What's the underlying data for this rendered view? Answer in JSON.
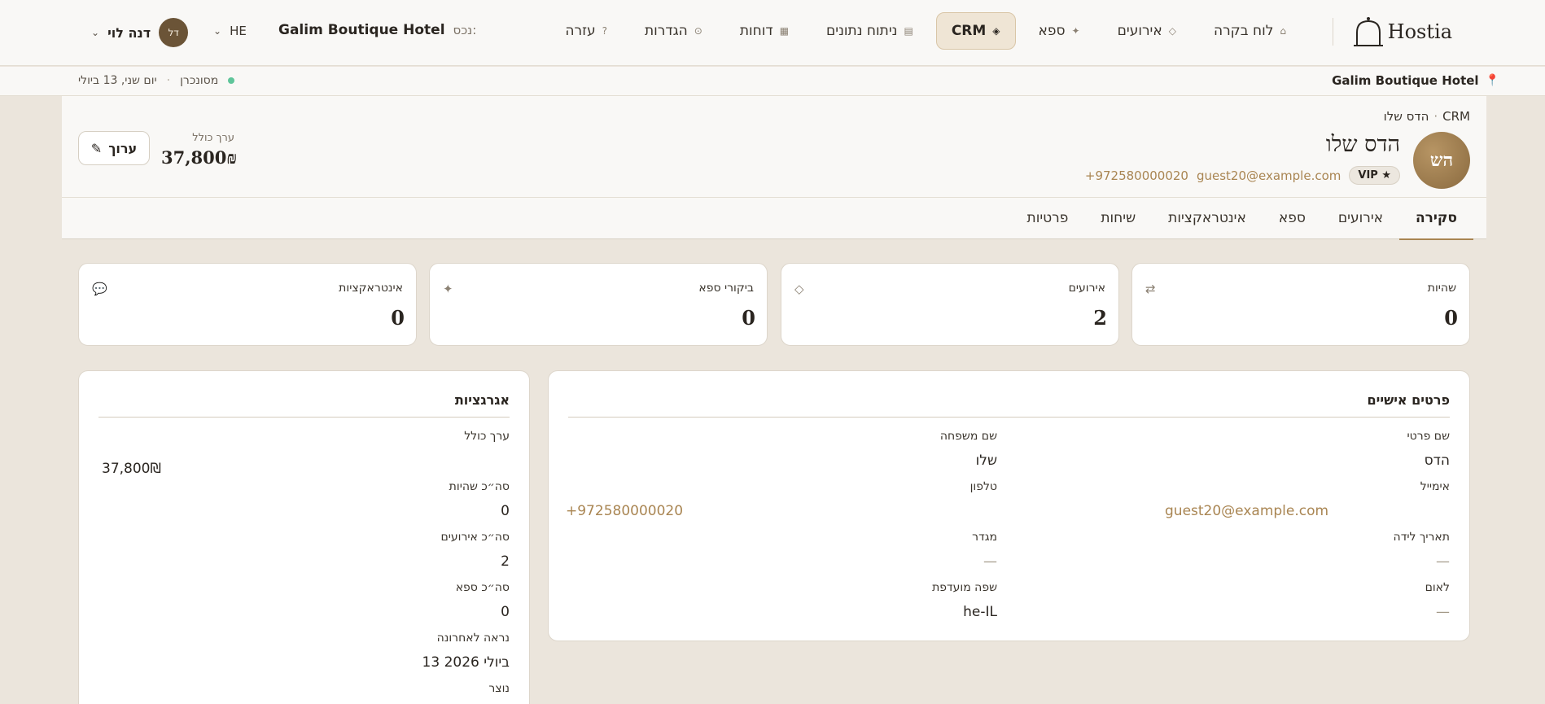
{
  "topnav": {
    "logo_text": "Hostia",
    "items": [
      {
        "label": "לוח בקרה",
        "icon": "⌂"
      },
      {
        "label": "אירועים",
        "icon": "◇"
      },
      {
        "label": "ספא",
        "icon": "✦"
      },
      {
        "label": "CRM",
        "icon": "◈",
        "active": true
      },
      {
        "label": "ניתוח נתונים",
        "icon": "▤"
      },
      {
        "label": "דוחות",
        "icon": "▦"
      },
      {
        "label": "הגדרות",
        "icon": "⊙"
      },
      {
        "label": "עזרה",
        "icon": "?"
      }
    ],
    "property_label": "נכס:",
    "property_name": "Galim Boutique Hotel",
    "language": "HE",
    "user_initials": "דל",
    "user_name": "דנה לוי"
  },
  "subbar": {
    "hotel": "Galim Boutique Hotel",
    "sync_status": "מסונכרן",
    "date": "יום שני, 13 ביולי"
  },
  "guest": {
    "breadcrumb_root": "CRM",
    "breadcrumb_current": "הדס שלו",
    "initials": "הש",
    "name": "הדס שלו",
    "vip_label": "VIP ★",
    "email": "guest20@example.com",
    "phone": "+972580000020",
    "ltv_label": "ערך כולל",
    "ltv_value": "37,800₪",
    "edit_label": "ערוך"
  },
  "tabs": [
    "סקירה",
    "אירועים",
    "ספא",
    "אינטראקציות",
    "שיחות",
    "פרטיות"
  ],
  "stats": [
    {
      "label": "שהיות",
      "value": "0",
      "icon": "⇄"
    },
    {
      "label": "אירועים",
      "value": "2",
      "icon": "◇"
    },
    {
      "label": "ביקורי ספא",
      "value": "0",
      "icon": "✦"
    },
    {
      "label": "אינטראקציות",
      "value": "0",
      "icon": "💬"
    }
  ],
  "personal": {
    "title": "פרטים אישיים",
    "first_name_label": "שם פרטי",
    "first_name": "הדס",
    "last_name_label": "שם משפחה",
    "last_name": "שלו",
    "email_label": "אימייל",
    "email": "guest20@example.com",
    "phone_label": "טלפון",
    "phone": "+972580000020",
    "dob_label": "תאריך לידה",
    "dob": "—",
    "gender_label": "מגדר",
    "gender": "—",
    "nationality_label": "לאום",
    "nationality": "—",
    "language_label": "שפה מועדפת",
    "language": "he-IL"
  },
  "aggregations": {
    "title": "אגרגציות",
    "total_value_label": "ערך כולל",
    "total_value": "37,800₪",
    "total_stays_label": "סה״כ שהיות",
    "total_stays": "0",
    "total_events_label": "סה״כ אירועים",
    "total_events": "2",
    "total_spa_label": "סה״כ ספא",
    "total_spa": "0",
    "last_seen_label": "נראה לאחרונה",
    "last_seen": "13 ביולי 2026",
    "created_label": "נוצר"
  }
}
